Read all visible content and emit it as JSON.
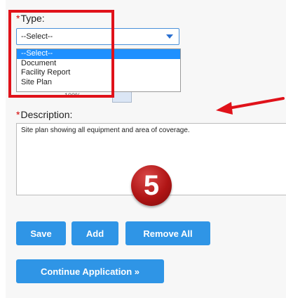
{
  "form": {
    "type_label": "Type:",
    "required_marker": "*",
    "type_select": {
      "value": "--Select--",
      "options": [
        "--Select--",
        "Document",
        "Facility Report",
        "Site Plan"
      ],
      "highlighted": "--Select--"
    },
    "partial_value": "100%",
    "description_label": "Description:",
    "description_value": "Site plan showing all equipment and area of coverage."
  },
  "annotations": {
    "step_number": "5",
    "highlight_color": "#e0121a",
    "arrow_color": "#e0121a"
  },
  "buttons": {
    "save": "Save",
    "add": "Add",
    "remove_all": "Remove All",
    "continue": "Continue Application »"
  },
  "colors": {
    "button_blue": "#2f95e6",
    "select_highlight": "#1e90ff",
    "required_red": "#d40000"
  }
}
